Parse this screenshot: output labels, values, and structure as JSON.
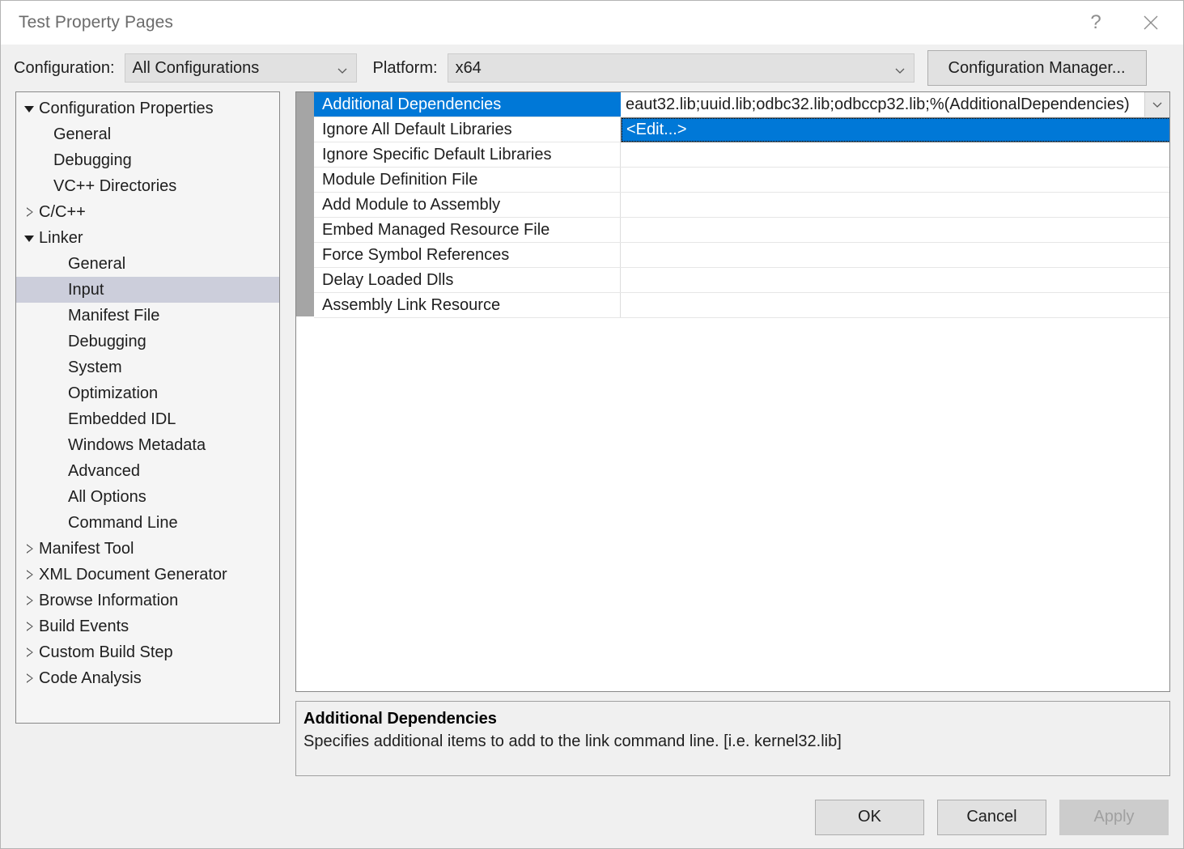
{
  "window": {
    "title": "Test Property Pages",
    "help_icon": "question-mark-icon",
    "close_icon": "close-icon"
  },
  "toolbar": {
    "configuration_label": "Configuration:",
    "configuration_value": "All Configurations",
    "platform_label": "Platform:",
    "platform_value": "x64",
    "configuration_manager_label": "Configuration Manager..."
  },
  "tree": {
    "items": [
      {
        "label": "Configuration Properties",
        "indent": 0,
        "expander": "open",
        "selected": false
      },
      {
        "label": "General",
        "indent": 1,
        "expander": "none",
        "selected": false
      },
      {
        "label": "Debugging",
        "indent": 1,
        "expander": "none",
        "selected": false
      },
      {
        "label": "VC++ Directories",
        "indent": 1,
        "expander": "none",
        "selected": false
      },
      {
        "label": "C/C++",
        "indent": 0,
        "expander": "closed",
        "selected": false
      },
      {
        "label": "Linker",
        "indent": 0,
        "expander": "open",
        "selected": false
      },
      {
        "label": "General",
        "indent": 2,
        "expander": "none",
        "selected": false
      },
      {
        "label": "Input",
        "indent": 2,
        "expander": "none",
        "selected": true
      },
      {
        "label": "Manifest File",
        "indent": 2,
        "expander": "none",
        "selected": false
      },
      {
        "label": "Debugging",
        "indent": 2,
        "expander": "none",
        "selected": false
      },
      {
        "label": "System",
        "indent": 2,
        "expander": "none",
        "selected": false
      },
      {
        "label": "Optimization",
        "indent": 2,
        "expander": "none",
        "selected": false
      },
      {
        "label": "Embedded IDL",
        "indent": 2,
        "expander": "none",
        "selected": false
      },
      {
        "label": "Windows Metadata",
        "indent": 2,
        "expander": "none",
        "selected": false
      },
      {
        "label": "Advanced",
        "indent": 2,
        "expander": "none",
        "selected": false
      },
      {
        "label": "All Options",
        "indent": 2,
        "expander": "none",
        "selected": false
      },
      {
        "label": "Command Line",
        "indent": 2,
        "expander": "none",
        "selected": false
      },
      {
        "label": "Manifest Tool",
        "indent": 0,
        "expander": "closed",
        "selected": false
      },
      {
        "label": "XML Document Generator",
        "indent": 0,
        "expander": "closed",
        "selected": false
      },
      {
        "label": "Browse Information",
        "indent": 0,
        "expander": "closed",
        "selected": false
      },
      {
        "label": "Build Events",
        "indent": 0,
        "expander": "closed",
        "selected": false
      },
      {
        "label": "Custom Build Step",
        "indent": 0,
        "expander": "closed",
        "selected": false
      },
      {
        "label": "Code Analysis",
        "indent": 0,
        "expander": "closed",
        "selected": false
      }
    ]
  },
  "grid": {
    "rows": [
      {
        "name": "Additional Dependencies",
        "value": "eaut32.lib;uuid.lib;odbc32.lib;odbccp32.lib;%(AdditionalDependencies)",
        "selected": true
      },
      {
        "name": "Ignore All Default Libraries",
        "value": "",
        "selected": false
      },
      {
        "name": "Ignore Specific Default Libraries",
        "value": "",
        "selected": false
      },
      {
        "name": "Module Definition File",
        "value": "",
        "selected": false
      },
      {
        "name": "Add Module to Assembly",
        "value": "",
        "selected": false
      },
      {
        "name": "Embed Managed Resource File",
        "value": "",
        "selected": false
      },
      {
        "name": "Force Symbol References",
        "value": "",
        "selected": false
      },
      {
        "name": "Delay Loaded Dlls",
        "value": "",
        "selected": false
      },
      {
        "name": "Assembly Link Resource",
        "value": "",
        "selected": false
      }
    ],
    "dropdown": {
      "open": true,
      "options": [
        "<Edit...>"
      ],
      "highlighted": "<Edit...>"
    }
  },
  "description": {
    "title": "Additional Dependencies",
    "text": "Specifies additional items to add to the link command line. [i.e. kernel32.lib]"
  },
  "footer": {
    "ok_label": "OK",
    "cancel_label": "Cancel",
    "apply_label": "Apply",
    "apply_disabled": true
  },
  "colors": {
    "selection_blue": "#0078D7",
    "tree_selection": "#CCCEDB",
    "dialog_bg": "#F0F0F0",
    "panel_bg": "#F5F5F5"
  }
}
